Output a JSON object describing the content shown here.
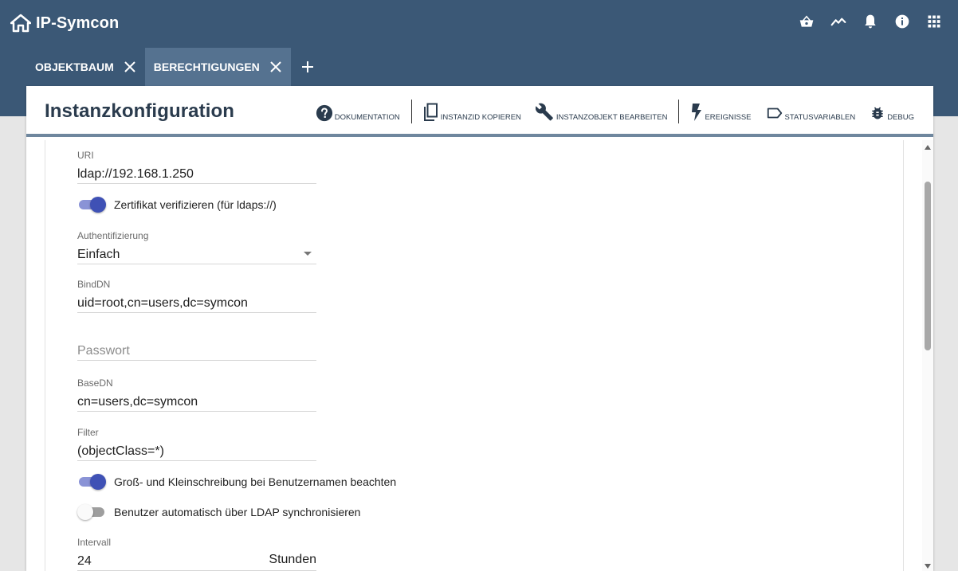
{
  "app": {
    "title": "IP-Symcon"
  },
  "topbar": {
    "icons": [
      "basket-icon",
      "trend-icon",
      "bell-icon",
      "info-icon",
      "apps-grid-icon"
    ]
  },
  "tabs": [
    {
      "label": "OBJEKTBAUM",
      "active": false
    },
    {
      "label": "BERECHTIGUNGEN",
      "active": true
    }
  ],
  "card": {
    "title": "Instanzkonfiguration",
    "actions": {
      "documentation": "DOKUMENTATION",
      "copy_id": "INSTANZID KOPIEREN",
      "edit_object": "INSTANZOBJEKT BEARBEITEN",
      "events": "EREIGNISSE",
      "status_vars": "STATUSVARIABLEN",
      "debug": "DEBUG"
    }
  },
  "form": {
    "uri": {
      "label": "URI",
      "value": "ldap://192.168.1.250"
    },
    "verify_cert": {
      "label": "Zertifikat verifizieren (für ldaps://)",
      "on": true
    },
    "auth": {
      "label": "Authentifizierung",
      "value": "Einfach"
    },
    "binddn": {
      "label": "BindDN",
      "value": "uid=root,cn=users,dc=symcon"
    },
    "password": {
      "placeholder": "Passwort"
    },
    "basedn": {
      "label": "BaseDN",
      "value": "cn=users,dc=symcon"
    },
    "filter": {
      "label": "Filter",
      "value": "(objectClass=*)"
    },
    "case_sensitive": {
      "label": "Groß- und Kleinschreibung bei Benutzernamen beachten",
      "on": true
    },
    "auto_sync": {
      "label": "Benutzer automatisch über LDAP synchronisieren",
      "on": false
    },
    "interval": {
      "label": "Intervall",
      "value": "24",
      "suffix": "Stunden"
    }
  },
  "colors": {
    "header": "#3b5876",
    "active_tab": "#557290",
    "accent": "#3f51b5"
  }
}
